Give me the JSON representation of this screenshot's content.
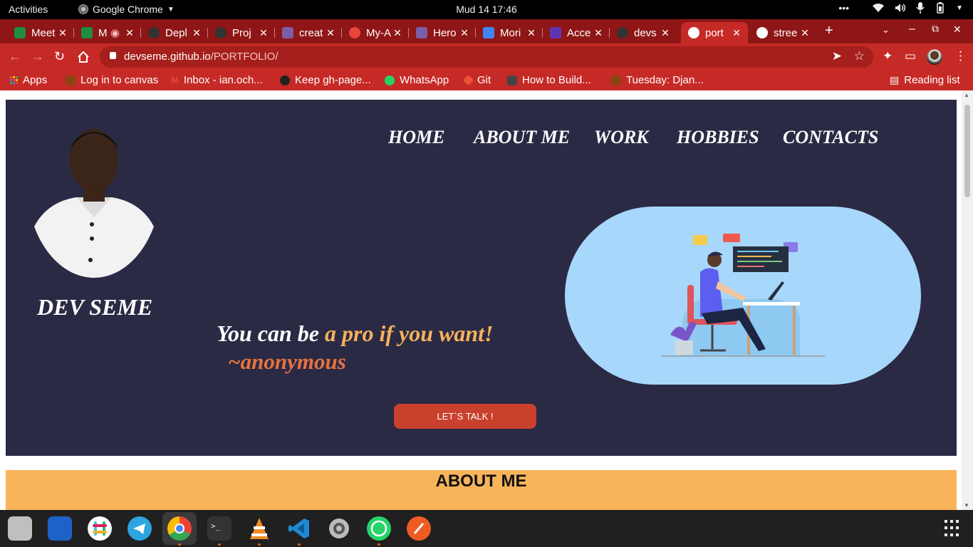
{
  "topbar": {
    "activities": "Activities",
    "app_name": "Google Chrome",
    "clock": "Mud 14  17:46",
    "overflow": "•••"
  },
  "tabs": [
    {
      "title": "Meet",
      "favicon_color": "#1e8e3e"
    },
    {
      "title": "M",
      "favicon_color": "#1e8e3e"
    },
    {
      "title": "Depl",
      "favicon_color": "#333333"
    },
    {
      "title": "Proj",
      "favicon_color": "#333333"
    },
    {
      "title": "creat",
      "favicon_color": "#7b5ea7"
    },
    {
      "title": "My-A",
      "favicon_color": "#e8453c"
    },
    {
      "title": "Hero",
      "favicon_color": "#7b5ea7"
    },
    {
      "title": "Mori",
      "favicon_color": "#4285f4"
    },
    {
      "title": "Acce",
      "favicon_color": "#5e35b1"
    },
    {
      "title": "devs",
      "favicon_color": "#333333"
    },
    {
      "title": "port",
      "favicon_color": "#ffffff",
      "active": true
    },
    {
      "title": "stree",
      "favicon_color": "#ffffff"
    }
  ],
  "toolbar": {
    "url_host": "devseme.github.io",
    "url_path": "/PORTFOLIO/"
  },
  "bookmarks": [
    {
      "label": "Apps",
      "icon": "apps-grid-icon",
      "color": "#f4b400"
    },
    {
      "label": "Log in to canvas",
      "icon": "canvas-icon",
      "color": "#8b4513"
    },
    {
      "label": "Inbox - ian.och...",
      "icon": "gmail-icon",
      "color": "#ea4335"
    },
    {
      "label": "Keep gh-page...",
      "icon": "github-icon",
      "color": "#222222"
    },
    {
      "label": "WhatsApp",
      "icon": "whatsapp-icon",
      "color": "#25d366"
    },
    {
      "label": "Git",
      "icon": "git-icon",
      "color": "#f05033"
    },
    {
      "label": "How to Build...",
      "icon": "site-icon",
      "color": "#444444"
    },
    {
      "label": "Tuesday: Djan...",
      "icon": "site-icon",
      "color": "#8b4513"
    }
  ],
  "reading_list": "Reading list",
  "page": {
    "nav": [
      "HOME",
      "ABOUT ME",
      "WORK",
      "HOBBIES",
      "CONTACTS"
    ],
    "name": "DEV SEME",
    "quote_plain": "You can be ",
    "quote_highlight": "a pro if you want!",
    "quote_author": "~anonymous",
    "cta": "LET`S TALK !",
    "about_heading": "ABOUT ME",
    "colors": {
      "hero_bg": "#2a2a45",
      "accent_orange": "#f7b15b",
      "author_orange": "#e8723e",
      "cta_red": "#c9402c",
      "about_bg": "#f8b45b",
      "illustration_bg": "#a7d7fa"
    }
  },
  "dock": [
    {
      "name": "files-icon"
    },
    {
      "name": "text-editor-icon"
    },
    {
      "name": "slack-icon"
    },
    {
      "name": "telegram-icon"
    },
    {
      "name": "chrome-icon",
      "running": true
    },
    {
      "name": "terminal-icon",
      "running": true
    },
    {
      "name": "vlc-icon",
      "running": true
    },
    {
      "name": "vscode-icon",
      "running": true
    },
    {
      "name": "settings-icon"
    },
    {
      "name": "whatsapp-icon",
      "running": true
    },
    {
      "name": "postman-icon"
    }
  ]
}
